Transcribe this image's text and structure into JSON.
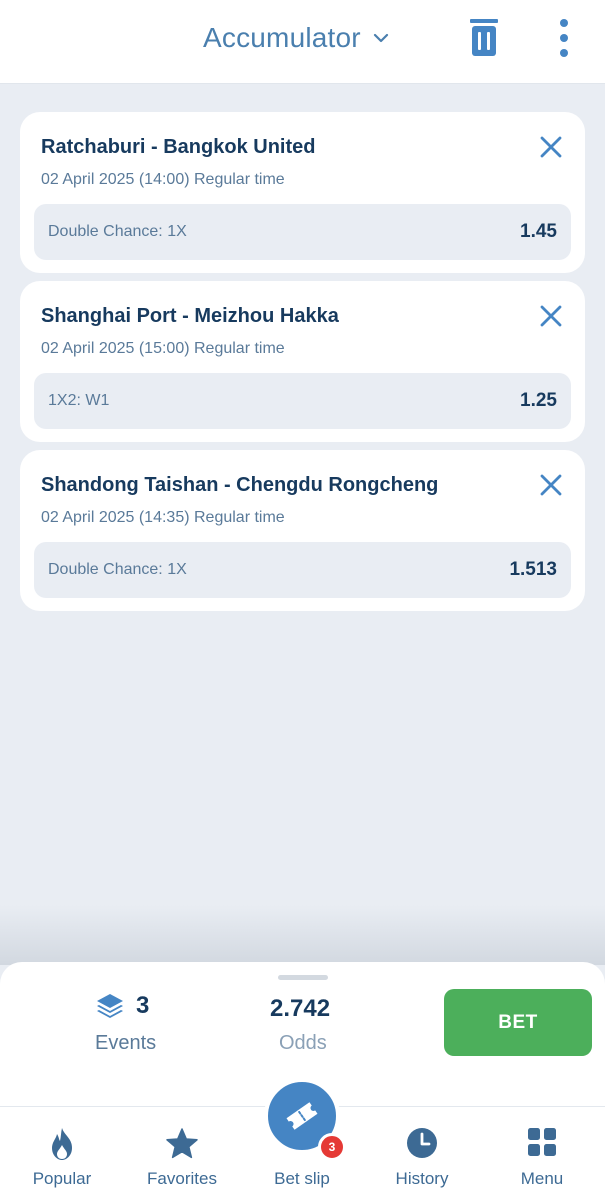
{
  "header": {
    "title": "Accumulator",
    "icons": [
      "chevron-down-icon",
      "trash-icon",
      "more-vertical-icon"
    ]
  },
  "bets": [
    {
      "match": "Ratchaburi - Bangkok United",
      "time": "02 April 2025 (14:00) Regular time",
      "market": "Double Chance: 1X",
      "odds": "1.45"
    },
    {
      "match": "Shanghai Port - Meizhou Hakka",
      "time": "02 April 2025 (15:00) Regular time",
      "market": "1X2: W1",
      "odds": "1.25"
    },
    {
      "match": "Shandong Taishan - Chengdu Rongcheng",
      "time": "02 April 2025 (14:35) Regular time",
      "market": "Double Chance: 1X",
      "odds": "1.513"
    }
  ],
  "summary": {
    "events_count": "3",
    "events_label": "Events",
    "odds_value": "2.742",
    "odds_label": "Odds",
    "bet_label": "BET"
  },
  "nav": {
    "items": [
      {
        "label": "Popular",
        "icon": "flame-icon"
      },
      {
        "label": "Favorites",
        "icon": "star-icon"
      },
      {
        "label": "Bet slip",
        "icon": "ticket-icon"
      },
      {
        "label": "History",
        "icon": "clock-icon"
      },
      {
        "label": "Menu",
        "icon": "grid-icon"
      }
    ],
    "betslip_badge": "3"
  },
  "colors": {
    "accent": "#4a7fae",
    "bet_button": "#4caf5b",
    "badge": "#e53935",
    "background": "#e9edf3",
    "text_dark": "#173a5e"
  }
}
